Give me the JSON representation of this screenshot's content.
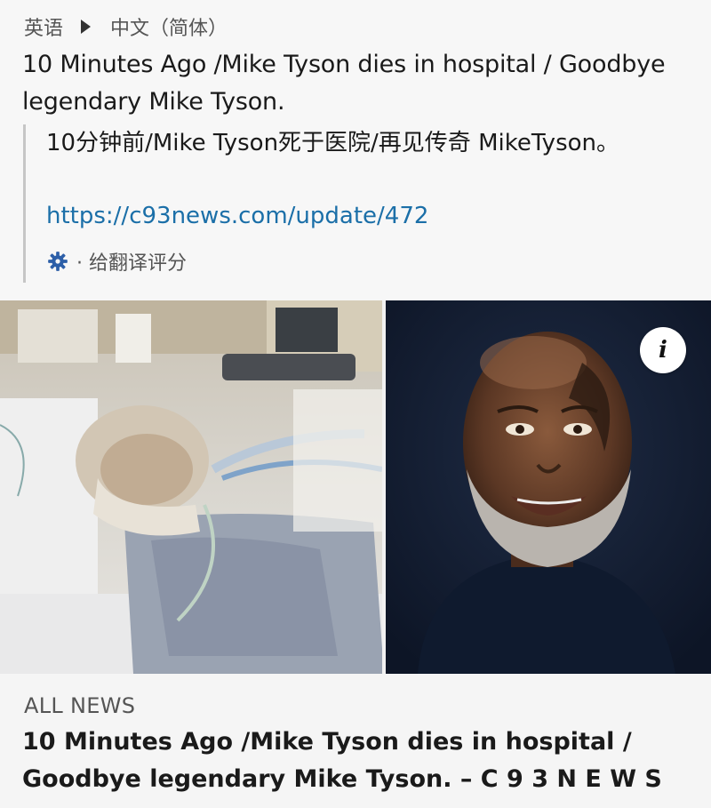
{
  "translation_header": {
    "source_lang": "英语",
    "target_lang": "中文（简体）"
  },
  "original_title": "10 Minutes Ago /Mike Tyson dies in hospital / Goodbye legendary Mike Tyson.",
  "translation": {
    "text": "10分钟前/Mike Tyson死于医院/再见传奇 MikeTyson。",
    "link": "https://c93news.com/update/472",
    "rate_label": "· 给翻译评分"
  },
  "link_card": {
    "info_icon": "info-icon",
    "source_label": "ALL NEWS",
    "title": "10 Minutes Ago /Mike Tyson dies in hospital / Goodbye legendary Mike Tyson. – C 9 3 N E W S"
  },
  "colors": {
    "link": "#1b6fa8",
    "gear_icon": "#2d5fa8",
    "background": "#f7f7f7"
  }
}
